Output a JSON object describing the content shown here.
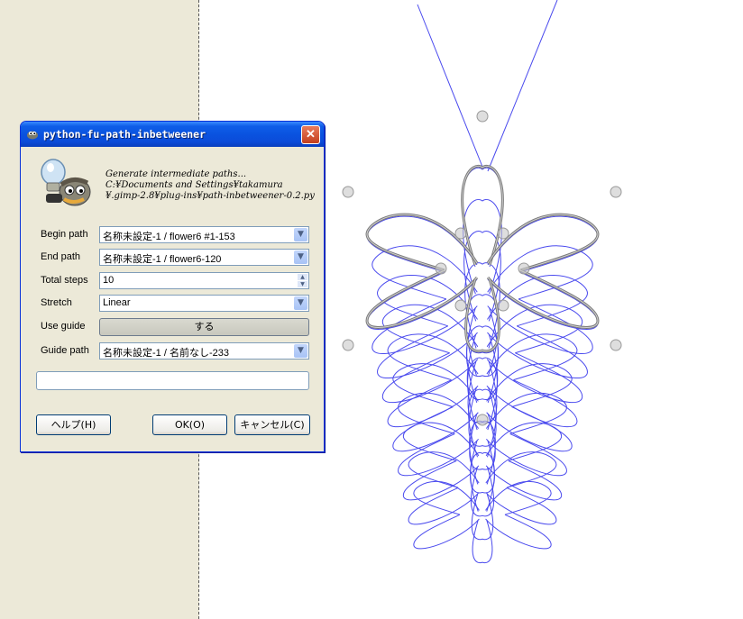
{
  "dialog": {
    "title": "python-fu-path-inbetweener",
    "close_glyph": "✕",
    "description_lines": [
      "Generate intermediate paths...",
      "C:¥Documents and Settings¥takamura",
      "¥.gimp-2.8¥plug-ins¥path-inbetweener-0.2.py"
    ],
    "fields": {
      "begin_path": {
        "label": "Begin path",
        "value": "名称未設定-1 / flower6 #1-153"
      },
      "end_path": {
        "label": "End path",
        "value": "名称未設定-1 / flower6-120"
      },
      "total_steps": {
        "label": "Total steps",
        "value": "10"
      },
      "stretch": {
        "label": "Stretch",
        "value": "Linear"
      },
      "use_guide": {
        "label": "Use guide",
        "value": "する"
      },
      "guide_path": {
        "label": "Guide path",
        "value": "名称未設定-1 / 名前なし-233"
      }
    },
    "progress_text": "",
    "buttons": {
      "help": "ヘルプ(H)",
      "ok": "OK(O)",
      "cancel": "キャンセル(C)"
    }
  },
  "icons": {
    "title_icon": "gimp-wilber-icon",
    "dialog_icon": "gimp-lightbulb-icon",
    "dropdown": "chevron-down-icon",
    "spin": "spin-updown-icon"
  },
  "colors": {
    "dialog_bg": "#ece9d8",
    "titlebar": "#0a53e0",
    "close_button": "#d4522b",
    "path_blue": "#4a4aee",
    "path_gray": "#7a7a7a"
  }
}
